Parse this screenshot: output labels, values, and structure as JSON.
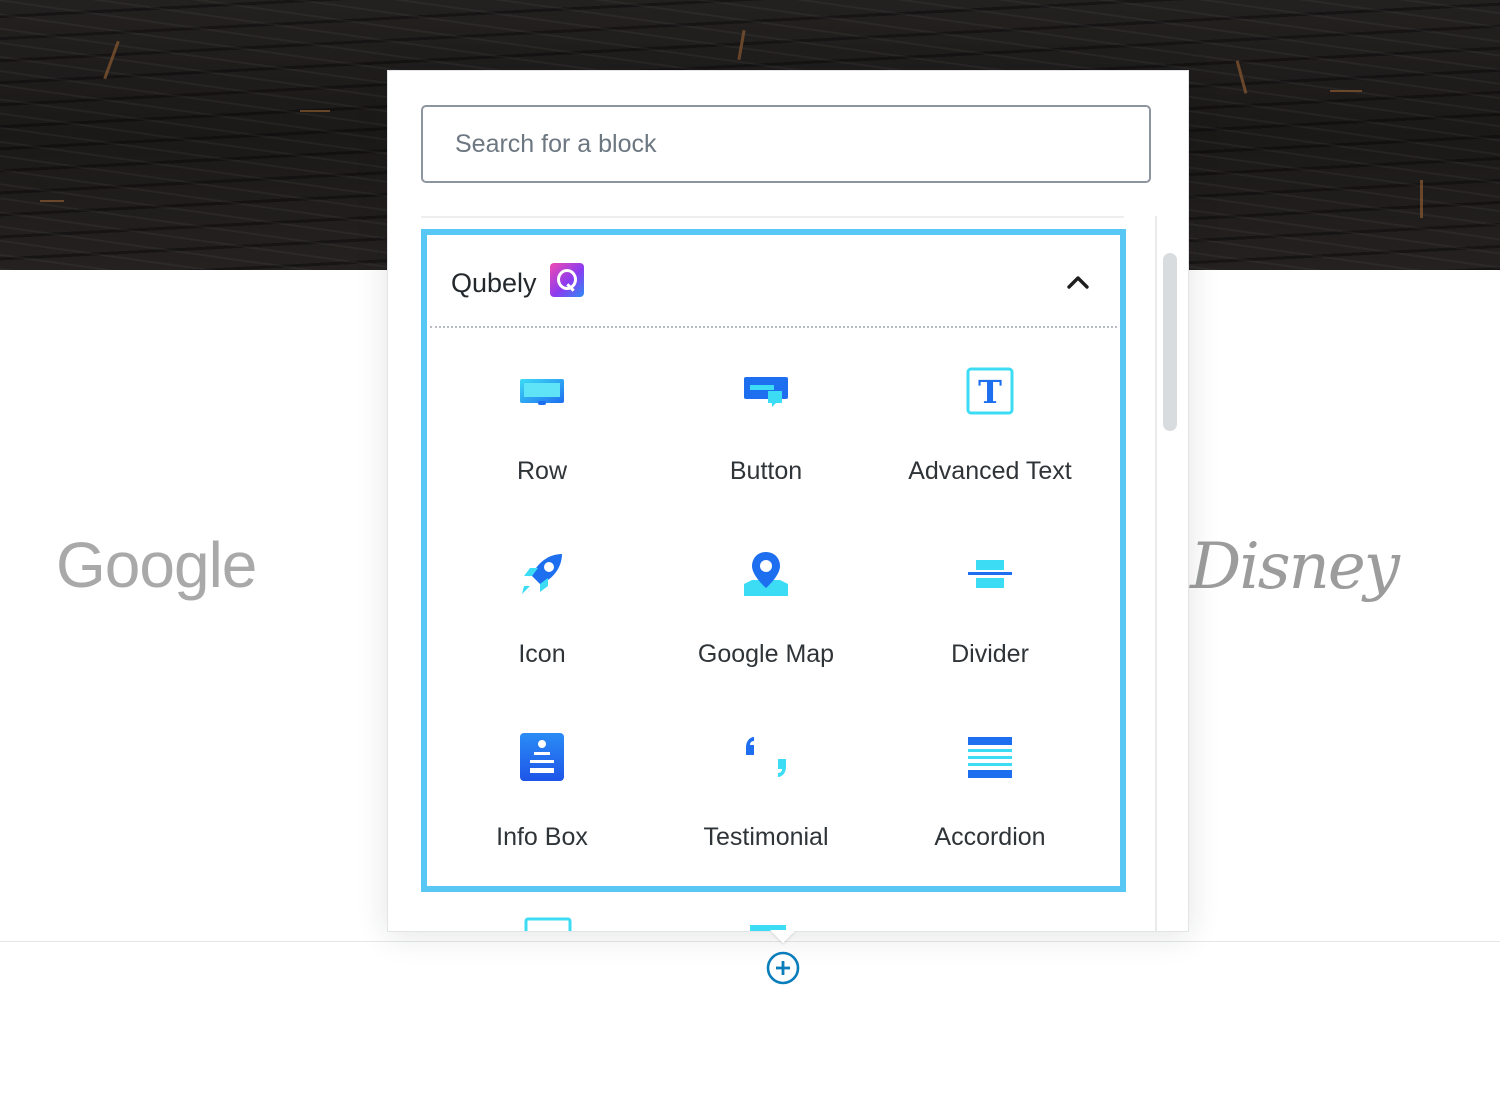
{
  "search": {
    "placeholder": "Search for a block",
    "value": ""
  },
  "category": {
    "title": "Qubely",
    "expanded": true
  },
  "blocks": [
    {
      "label": "Row",
      "icon": "row-icon"
    },
    {
      "label": "Button",
      "icon": "button-block-icon"
    },
    {
      "label": "Advanced Text",
      "icon": "advanced-text-icon"
    },
    {
      "label": "Icon",
      "icon": "rocket-icon"
    },
    {
      "label": "Google Map",
      "icon": "map-pin-icon"
    },
    {
      "label": "Divider",
      "icon": "divider-icon"
    },
    {
      "label": "Info Box",
      "icon": "info-box-icon"
    },
    {
      "label": "Testimonial",
      "icon": "quote-icon"
    },
    {
      "label": "Accordion",
      "icon": "accordion-icon"
    }
  ],
  "background_logos": {
    "left": "Google",
    "right": "Disney"
  },
  "colors": {
    "highlight": "#58c7f3",
    "icon_light": "#3ddcf5",
    "icon_dark": "#1e6ff0",
    "text": "#2f3438"
  }
}
